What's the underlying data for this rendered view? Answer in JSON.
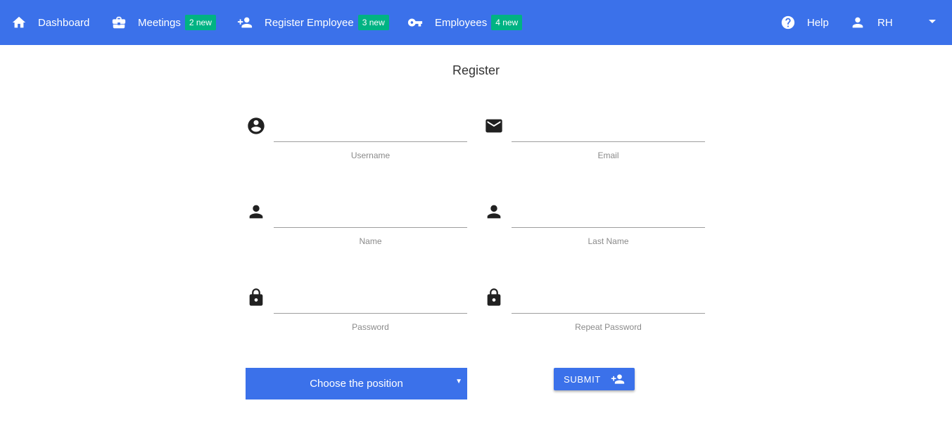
{
  "nav": {
    "dashboard": {
      "label": "Dashboard",
      "icon": "home-icon"
    },
    "meetings": {
      "label": "Meetings",
      "badge": "2 new",
      "icon": "briefcase-icon"
    },
    "register": {
      "label": "Register Employee",
      "badge": "3 new",
      "icon": "person-add-icon"
    },
    "employees": {
      "label": "Employees",
      "badge": "4 new",
      "icon": "key-icon"
    },
    "help": {
      "label": "Help",
      "icon": "help-circle-icon"
    },
    "user": {
      "label": "RH",
      "icon": "person-icon"
    }
  },
  "form": {
    "title": "Register",
    "username": {
      "label": "Username",
      "value": "",
      "icon": "account-circle-icon"
    },
    "email": {
      "label": "Email",
      "value": "",
      "icon": "mail-icon"
    },
    "name": {
      "label": "Name",
      "value": "",
      "icon": "person-icon"
    },
    "last_name": {
      "label": "Last Name",
      "value": "",
      "icon": "person-icon"
    },
    "password": {
      "label": "Password",
      "value": "",
      "icon": "lock-icon"
    },
    "repeat_password": {
      "label": "Repeat Password",
      "value": "",
      "icon": "lock-icon"
    },
    "position": {
      "selected": "Choose the position"
    },
    "submit_label": "SUBMIT"
  },
  "colors": {
    "primary": "#3b71ea",
    "badge": "#00b383"
  }
}
